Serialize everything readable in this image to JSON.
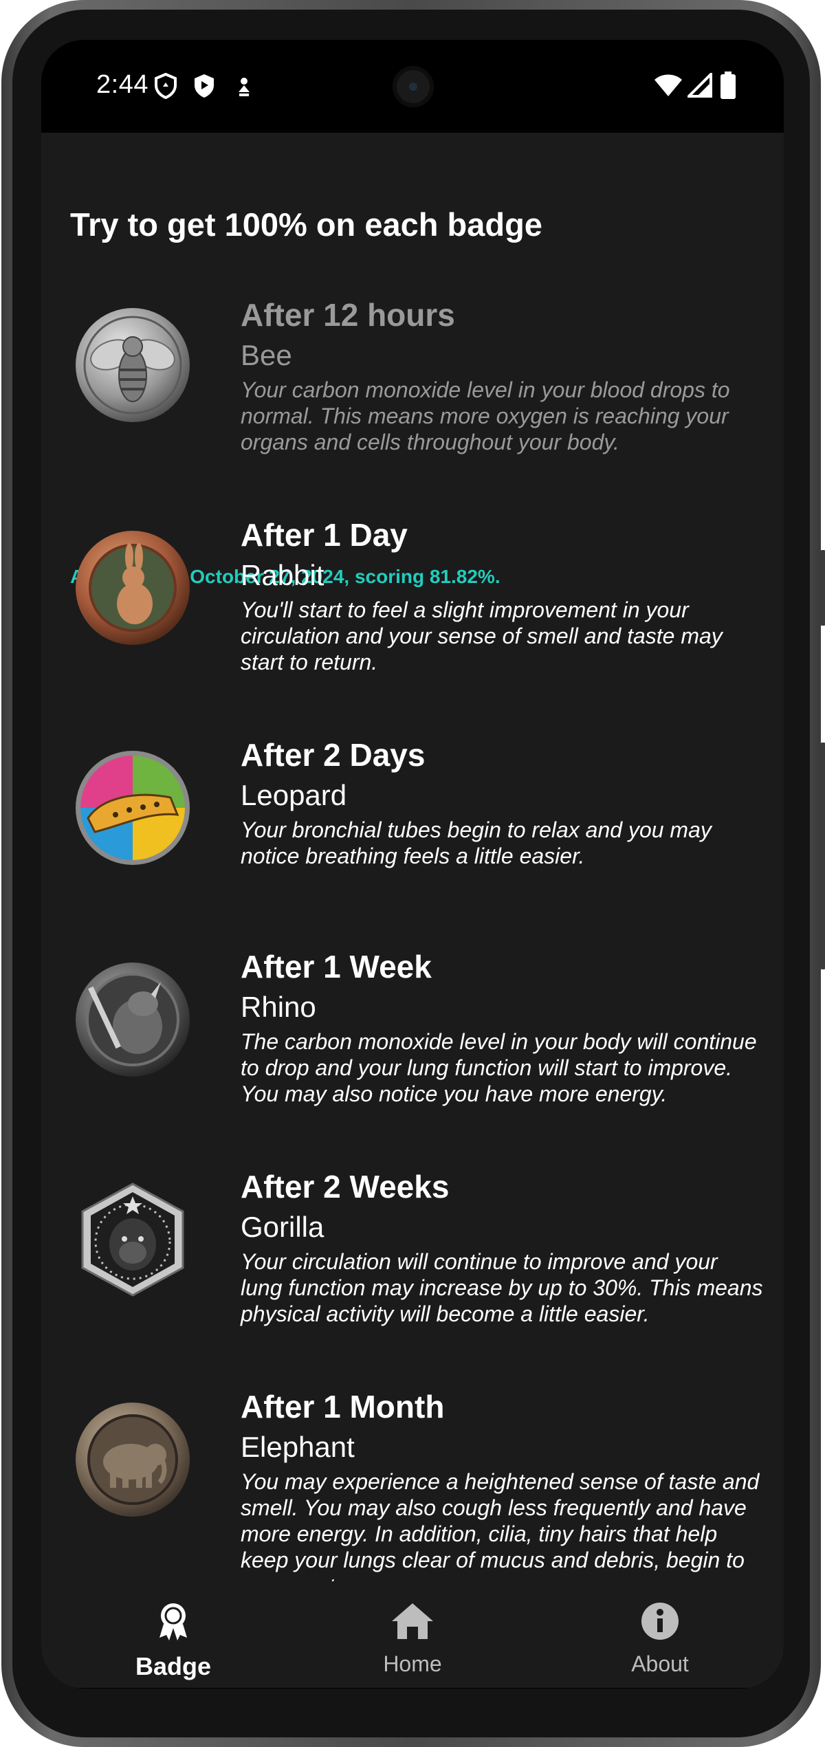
{
  "status_bar": {
    "time": "2:44",
    "left_icons": [
      "shield-outline-icon",
      "play-shield-icon",
      "location-person-icon"
    ],
    "right_icons": [
      "wifi-icon",
      "signal-icon",
      "battery-icon"
    ]
  },
  "page": {
    "heading": "Try to get 100% on each badge",
    "achievement_note": "Achieved on October 27, 2024, scoring 81.82%.",
    "accent_color": "#22cdbd"
  },
  "badges": [
    {
      "title": "After 12 hours",
      "animal": "Bee",
      "description": "Your carbon monoxide level in your blood drops to normal. This means more oxygen is reaching your organs and cells throughout your body.",
      "icon": "bee-medal-icon",
      "dimmed": true
    },
    {
      "title": "After 1 Day",
      "animal": "Rabbit",
      "description": "You'll start to feel a slight improvement in your circulation and your sense of smell and taste may start to return.",
      "icon": "rabbit-medal-icon"
    },
    {
      "title": "After 2 Days",
      "animal": "Leopard",
      "description": "Your bronchial tubes begin to relax and you may notice breathing feels a little easier.",
      "icon": "leopard-medal-icon"
    },
    {
      "title": "After 1 Week",
      "animal": "Rhino",
      "description": "The carbon monoxide level in your body will continue to drop and your lung function will start to improve. You may also notice you have more energy.",
      "icon": "rhino-medal-icon"
    },
    {
      "title": "After 2 Weeks",
      "animal": "Gorilla",
      "description": "Your circulation will continue to improve and your lung function may increase by up to 30%. This means physical activity will become a little easier.",
      "icon": "gorilla-medal-icon"
    },
    {
      "title": "After 1 Month",
      "animal": "Elephant",
      "description": "You may experience a heightened sense of taste and smell. You may also cough less frequently and have more energy. In addition, cilia, tiny hairs that help keep your lungs clear of mucus and debris, begin to regenerate.",
      "icon": "elephant-medal-icon"
    }
  ],
  "bottom_nav": [
    {
      "label": "Badge",
      "icon": "badge-ribbon-icon",
      "active": true
    },
    {
      "label": "Home",
      "icon": "home-icon",
      "active": false
    },
    {
      "label": "About",
      "icon": "info-icon",
      "active": false
    }
  ]
}
